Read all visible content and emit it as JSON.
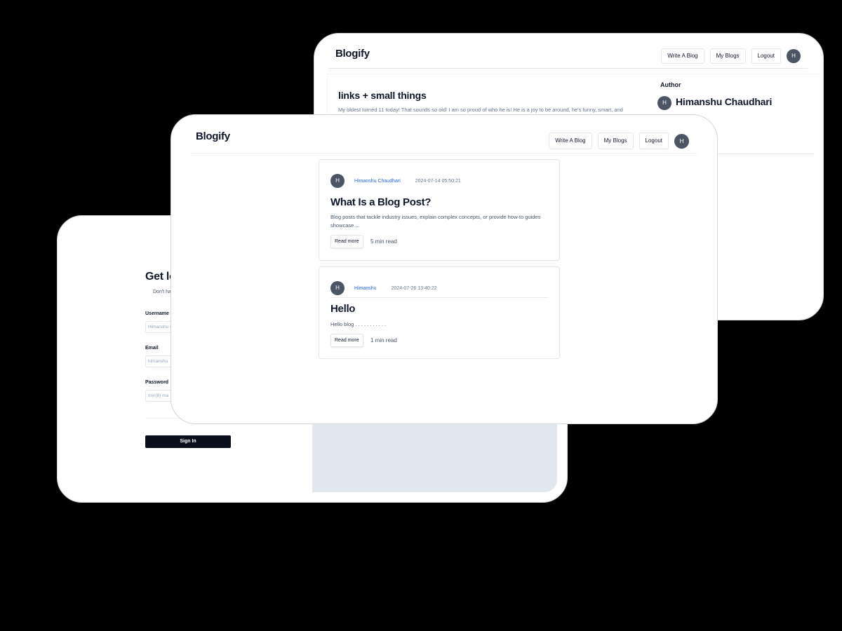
{
  "signin": {
    "title": "Get lo",
    "subtitle": "Don't ha",
    "username_label": "Username",
    "username_placeholder": "Himanshu C",
    "email_label": "Email",
    "email_placeholder": "himanshu",
    "password_label": "Password",
    "password_placeholder": "min(8) ma",
    "signin_button": "Sign In"
  },
  "detail": {
    "logo": "Blogify",
    "nav": [
      "Write A Blog",
      "My Blogs",
      "Logout"
    ],
    "avatar": "H",
    "post_title": "links + small things",
    "post_body": "My oldest turned 11 today! That sounds so old! I am so proud of who he is! He is a joy to be around, he's funny, smart, and",
    "author_heading": "Author",
    "author_avatar": "H",
    "author_name": "Himanshu Chaudhari"
  },
  "list": {
    "logo": "Blogify",
    "nav": [
      "Write A Blog",
      "My Blogs",
      "Logout"
    ],
    "avatar": "H",
    "posts": [
      {
        "avatar": "H",
        "author": "Himanshu Chaudhari",
        "date": "2024-07-14 05:50:21",
        "title": "What Is a Blog Post?",
        "excerpt": "Blog posts that tackle industry issues, explain complex concepts, or provide how-to guides showcase ...",
        "read_more": "Read more",
        "read_time": "5 min read"
      },
      {
        "avatar": "H",
        "author": "Himanshu",
        "date": "2024-07-26 13:40:22",
        "title": "Hello",
        "excerpt": "Hello blog . . . . . . . . . . .",
        "read_more": "Read more",
        "read_time": "1 min read"
      }
    ]
  },
  "colors": {
    "background": "#000000",
    "primary_button": "#0b0f1c",
    "author_link": "#2563eb",
    "avatar": "#4b5563",
    "panel": "#e2e8f0"
  }
}
